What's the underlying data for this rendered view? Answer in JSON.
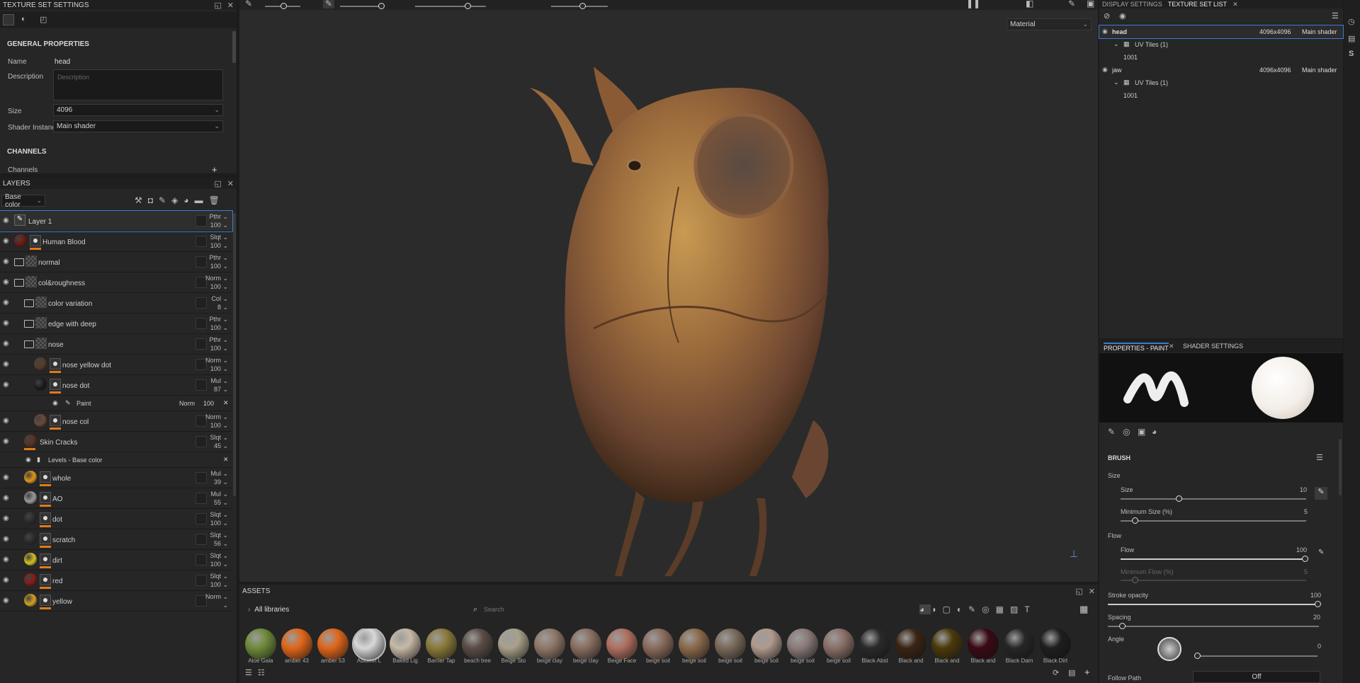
{
  "texture_set_settings": {
    "title": "TEXTURE SET SETTINGS",
    "section_general": "GENERAL PROPERTIES",
    "name_label": "Name",
    "name_value": "head",
    "description_label": "Description",
    "description_placeholder": "Description",
    "size_label": "Size",
    "size_value": "4096",
    "shader_label": "Shader Instance",
    "shader_value": "Main shader",
    "section_channels": "CHANNELS",
    "channels_label": "Channels"
  },
  "layers": {
    "title": "LAYERS",
    "channel_select": "Base color",
    "items": [
      {
        "name": "Layer 1",
        "blend": "Pthr",
        "opacity": "100"
      },
      {
        "name": "Human Blood",
        "blend": "Slqt",
        "opacity": "100"
      },
      {
        "name": "normal",
        "blend": "Pthr",
        "opacity": "100"
      },
      {
        "name": "col&roughness",
        "blend": "Norm",
        "opacity": "100"
      },
      {
        "name": "color variation",
        "blend": "Col",
        "opacity": "8"
      },
      {
        "name": "edge with deep",
        "blend": "Pthr",
        "opacity": "100"
      },
      {
        "name": "nose",
        "blend": "Pthr",
        "opacity": "100"
      },
      {
        "name": "nose yellow dot",
        "blend": "Norm",
        "opacity": "100"
      },
      {
        "name": "nose dot",
        "blend": "Mul",
        "opacity": "87"
      },
      {
        "name": "nose col",
        "blend": "Norm",
        "opacity": "100"
      },
      {
        "name": "Skin Cracks",
        "blend": "Slqt",
        "opacity": "45"
      },
      {
        "name": "whole",
        "blend": "Mul",
        "opacity": "39"
      },
      {
        "name": "AO",
        "blend": "Mul",
        "opacity": "55"
      },
      {
        "name": "dot",
        "blend": "Slqt",
        "opacity": "100"
      },
      {
        "name": "scratch",
        "blend": "Slqt",
        "opacity": "56"
      },
      {
        "name": "dirt",
        "blend": "Slqt",
        "opacity": "100"
      },
      {
        "name": "red",
        "blend": "Slqt",
        "opacity": "100"
      },
      {
        "name": "yellow",
        "blend": "Norm",
        "opacity": ""
      }
    ],
    "paint_sub": {
      "name": "Paint",
      "blend": "Norm",
      "opacity": "100"
    },
    "levels_sub": {
      "name": "Levels - Base color"
    }
  },
  "viewport": {
    "mode_select": "Material"
  },
  "assets": {
    "title": "ASSETS",
    "library": "All libraries",
    "search_placeholder": "Search",
    "materials": [
      "Aloe Gala",
      "amber 43",
      "amber 53",
      "Autumn L",
      "Baked Lig",
      "Barrier Tap",
      "beach tree",
      "Beige Sto",
      "beige clay",
      "beige clay",
      "Beige Face",
      "beige soil",
      "beige soil",
      "beige soil",
      "beige soil",
      "beige soil",
      "beige soil",
      "Black Abst",
      "Black and",
      "Black and",
      "Black and",
      "Black Dam",
      "Black Dirt"
    ],
    "colors": [
      "#6f8a3a",
      "#e0661a",
      "#e0661a",
      "#d8d8d8",
      "#c7b9a6",
      "#8a7a3a",
      "#5a4c46",
      "#a8a08a",
      "#8f7868",
      "#8a6e60",
      "#b07060",
      "#8a6c5c",
      "#8a6a4a",
      "#7a6a5a",
      "#b09a8c",
      "#8a7a78",
      "#8a7068",
      "#2a2a2a",
      "#3a2414",
      "#4a3a0a",
      "#3a0a14",
      "#262626",
      "#1e1e20"
    ]
  },
  "texture_set_list": {
    "tab_display": "DISPLAY SETTINGS",
    "tab_list": "TEXTURE SET LIST",
    "sets": [
      {
        "name": "head",
        "res": "4096x4096",
        "shader": "Main shader",
        "uv": "UV Tiles (1)",
        "tile": "1001"
      },
      {
        "name": "jaw",
        "res": "4096x4096",
        "shader": "Main shader",
        "uv": "UV Tiles (1)",
        "tile": "1001"
      }
    ]
  },
  "properties": {
    "tab_paint": "PROPERTIES - PAINT",
    "tab_shader": "SHADER SETTINGS",
    "brush": "BRUSH",
    "size_group": "Size",
    "size_label": "Size",
    "size_value": "10",
    "min_size_label": "Minimum Size (%)",
    "min_size_value": "5",
    "flow_group": "Flow",
    "flow_label": "Flow",
    "flow_value": "100",
    "min_flow_label": "Minimum Flow (%)",
    "min_flow_value": "5",
    "stroke_label": "Stroke opacity",
    "stroke_value": "100",
    "spacing_label": "Spacing",
    "spacing_value": "20",
    "angle_label": "Angle",
    "angle_value": "0",
    "follow_label": "Follow Path",
    "follow_value": "Off"
  }
}
